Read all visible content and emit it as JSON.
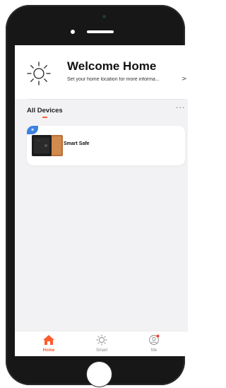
{
  "header": {
    "title": "Welcome Home",
    "subtitle": "Set your home location for more informa...",
    "arrow": ">",
    "icon": "sun-icon"
  },
  "devices_section": {
    "label": "All Devices",
    "more": "···"
  },
  "devices": [
    {
      "name": "Smart Safe",
      "badge_icon": "bluetooth-icon",
      "badge_glyph": "✶",
      "image_icon": "safe-icon"
    }
  ],
  "tabbar": {
    "tabs": [
      {
        "label": "Home",
        "icon": "home-icon",
        "active": true
      },
      {
        "label": "Smart",
        "icon": "sun-icon",
        "active": false
      },
      {
        "label": "Me",
        "icon": "profile-icon",
        "active": false
      }
    ]
  },
  "colors": {
    "accent": "#ff5b2e",
    "bluetooth": "#3b82e0",
    "background": "#f2f2f4"
  }
}
